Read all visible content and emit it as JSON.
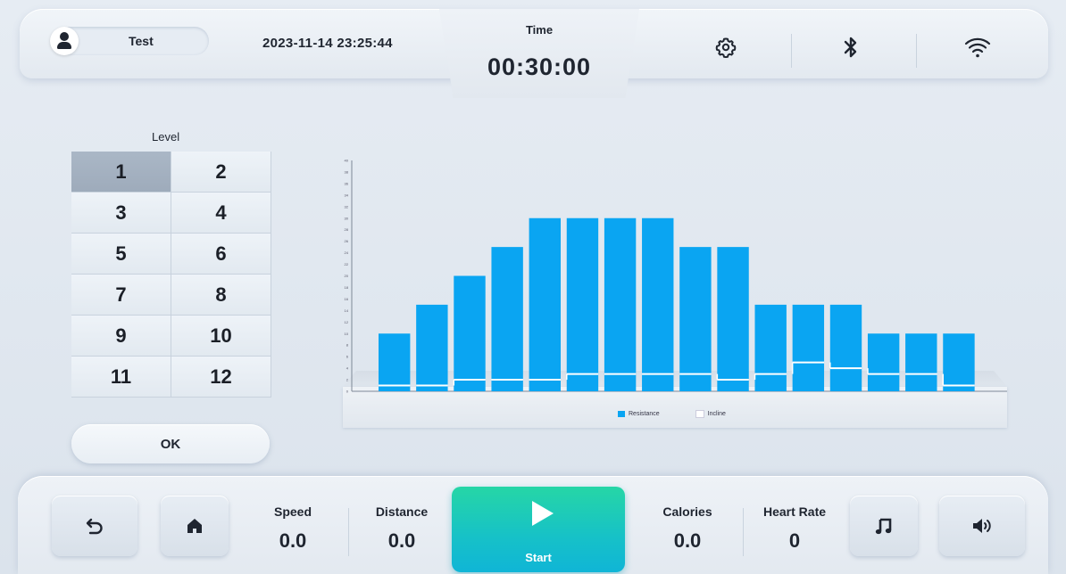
{
  "header": {
    "user_name": "Test",
    "datetime": "2023-11-14 23:25:44",
    "time_label": "Time",
    "time_value": "00:30:00"
  },
  "icons": {
    "user": "user-icon",
    "settings": "gear-icon",
    "bluetooth": "bluetooth-icon",
    "wifi": "wifi-icon",
    "back": "back-arrow-icon",
    "home": "home-icon",
    "play": "play-icon",
    "music": "music-note-icon",
    "volume": "volume-icon"
  },
  "level": {
    "title": "Level",
    "selected": "1",
    "options": [
      "1",
      "2",
      "3",
      "4",
      "5",
      "6",
      "7",
      "8",
      "9",
      "10",
      "11",
      "12"
    ],
    "ok_label": "OK"
  },
  "chart_data": {
    "type": "bar",
    "ylim": [
      0,
      40
    ],
    "yticks": [
      "0",
      "2",
      "4",
      "6",
      "8",
      "10",
      "12",
      "14",
      "16",
      "18",
      "20",
      "22",
      "24",
      "26",
      "28",
      "30",
      "32",
      "34",
      "36",
      "38",
      "40"
    ],
    "series": [
      {
        "name": "Resistance",
        "color": "#0aa5f2",
        "values": [
          10,
          15,
          20,
          25,
          30,
          30,
          30,
          30,
          25,
          25,
          15,
          15,
          15,
          10,
          10,
          10
        ]
      },
      {
        "name": "Incline",
        "color": "#ffffff",
        "values": [
          1,
          1,
          2,
          2,
          2,
          3,
          3,
          3,
          3,
          2,
          3,
          5,
          4,
          3,
          3,
          1
        ]
      }
    ]
  },
  "stats": {
    "speed_label": "Speed",
    "speed_value": "0.0",
    "distance_label": "Distance",
    "distance_value": "0.0",
    "calories_label": "Calories",
    "calories_value": "0.0",
    "heart_rate_label": "Heart Rate",
    "heart_rate_value": "0"
  },
  "start": {
    "label": "Start",
    "color": "#1cc8b8"
  }
}
